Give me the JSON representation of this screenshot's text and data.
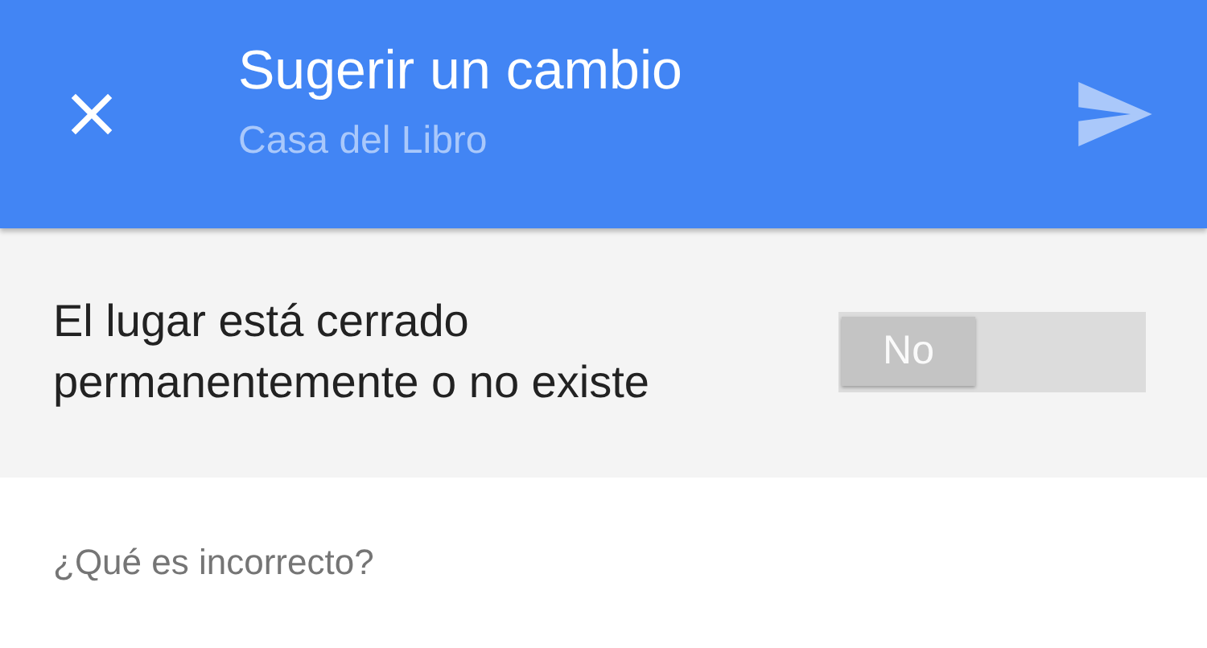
{
  "header": {
    "title": "Sugerir un cambio",
    "subtitle": "Casa del Libro",
    "send_disabled": true
  },
  "closed_toggle": {
    "label": "El lugar está cerrado permanentemente o no existe",
    "state_text": "No",
    "on": false
  },
  "question": {
    "text": "¿Qué es incorrecto?"
  }
}
